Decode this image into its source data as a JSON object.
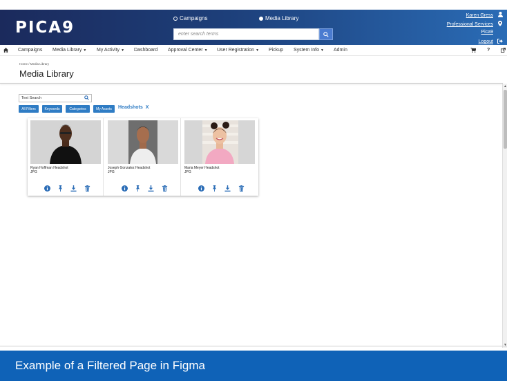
{
  "logo": {
    "text": "PICA9"
  },
  "header": {
    "radio_options": [
      {
        "label": "Campaigns",
        "selected": false
      },
      {
        "label": "Media Library",
        "selected": true
      }
    ],
    "search_placeholder": "enter search terms",
    "user_name": "Karen Gress",
    "department": "Professional Services",
    "org": "Pica9",
    "logout": "Logout"
  },
  "nav": {
    "items": [
      {
        "label": "Campaigns",
        "dropdown": false
      },
      {
        "label": "Media Library",
        "dropdown": true
      },
      {
        "label": "My Activity",
        "dropdown": true
      },
      {
        "label": "Dashboard",
        "dropdown": false
      },
      {
        "label": "Approval Center",
        "dropdown": true
      },
      {
        "label": "User Registration",
        "dropdown": true
      },
      {
        "label": "Pickup",
        "dropdown": false
      },
      {
        "label": "System Info",
        "dropdown": true
      },
      {
        "label": "Admin",
        "dropdown": false
      }
    ],
    "help": "?"
  },
  "breadcrumb": "Home / Media Library",
  "page_title": "Media Library",
  "filters": {
    "text_search_placeholder": "Text Search",
    "buttons": [
      "All Filters",
      "Keywords",
      "Categories",
      "My Assets"
    ],
    "active_filter": "Headshots",
    "active_filter_remove": "X"
  },
  "assets": [
    {
      "name": "Ryan Hoffman Headshot",
      "type": "JPG"
    },
    {
      "name": "Joseph Gonzalez Headshot",
      "type": "JPG"
    },
    {
      "name": "Maria Meyer Headshot",
      "type": "JPG"
    }
  ],
  "footer": {
    "text": "Example of a Filtered Page in Figma"
  },
  "colors": {
    "brand_blue": "#0f62b7",
    "filter_blue": "#2f7cc4",
    "header_dark": "#1b2a5c"
  }
}
